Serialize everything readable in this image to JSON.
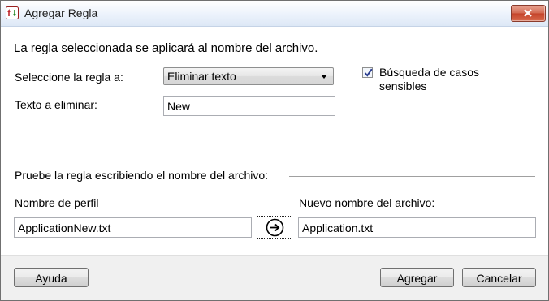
{
  "window": {
    "title": "Agregar Regla"
  },
  "main": {
    "heading": "La regla seleccionada se aplicará al nombre del archivo.",
    "rule_label": "Seleccione la regla a:",
    "rule_value": "Eliminar texto",
    "case_label_line1": "Búsqueda de casos",
    "case_label_line2": "sensibles",
    "case_checked": true,
    "text_label": "Texto a eliminar:",
    "text_value": "New",
    "test_group_label": "Pruebe la regla escribiendo el nombre del archivo:",
    "profile_label": "Nombre de perfil",
    "profile_value": "ApplicationNew.txt",
    "new_name_label": "Nuevo nombre del archivo:",
    "new_name_value": "Application.txt"
  },
  "footer": {
    "help_label": "Ayuda",
    "add_label": "Agregar",
    "cancel_label": "Cancelar"
  }
}
